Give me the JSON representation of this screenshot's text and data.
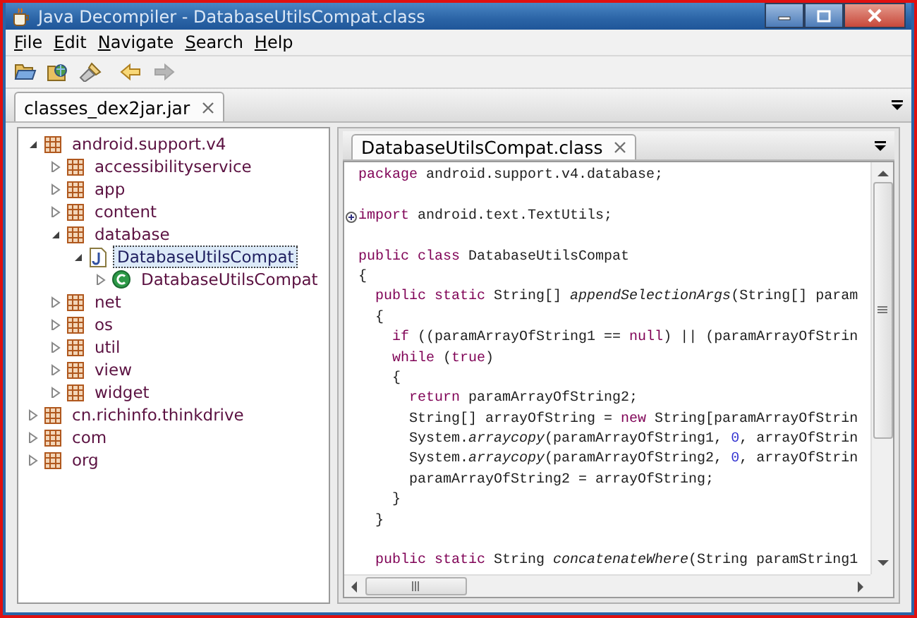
{
  "window": {
    "title": "Java Decompiler - DatabaseUtilsCompat.class"
  },
  "menu": [
    {
      "label": "File"
    },
    {
      "label": "Edit"
    },
    {
      "label": "Navigate"
    },
    {
      "label": "Search"
    },
    {
      "label": "Help"
    }
  ],
  "toolbar": [
    {
      "kind": "open",
      "disabled": false
    },
    {
      "kind": "open-type",
      "disabled": false
    },
    {
      "kind": "search",
      "disabled": false
    },
    {
      "kind": "back",
      "disabled": false
    },
    {
      "kind": "forward",
      "disabled": true
    }
  ],
  "file_tabs": [
    {
      "label": "classes_dex2jar.jar",
      "selected": true
    }
  ],
  "tree": [
    {
      "label": "android.support.v4",
      "kind": "package",
      "expanded": true,
      "selected": false,
      "children": [
        {
          "label": "accessibilityservice",
          "kind": "package",
          "expanded": false,
          "selected": false
        },
        {
          "label": "app",
          "kind": "package",
          "expanded": false,
          "selected": false
        },
        {
          "label": "content",
          "kind": "package",
          "expanded": false,
          "selected": false
        },
        {
          "label": "database",
          "kind": "package",
          "expanded": true,
          "selected": false,
          "children": [
            {
              "label": "DatabaseUtilsCompat",
              "kind": "file",
              "expanded": true,
              "selected": true,
              "children": [
                {
                  "label": "DatabaseUtilsCompat",
                  "kind": "class",
                  "expanded": false,
                  "selected": false
                }
              ]
            }
          ]
        },
        {
          "label": "net",
          "kind": "package",
          "expanded": false,
          "selected": false
        },
        {
          "label": "os",
          "kind": "package",
          "expanded": false,
          "selected": false
        },
        {
          "label": "util",
          "kind": "package",
          "expanded": false,
          "selected": false
        },
        {
          "label": "view",
          "kind": "package",
          "expanded": false,
          "selected": false
        },
        {
          "label": "widget",
          "kind": "package",
          "expanded": false,
          "selected": false
        }
      ]
    },
    {
      "label": "cn.richinfo.thinkdrive",
      "kind": "package",
      "expanded": false,
      "selected": false
    },
    {
      "label": "com",
      "kind": "package",
      "expanded": false,
      "selected": false
    },
    {
      "label": "org",
      "kind": "package",
      "expanded": false,
      "selected": false
    }
  ],
  "editor_tabs": [
    {
      "label": "DatabaseUtilsCompat.class",
      "selected": true
    }
  ],
  "code": {
    "lines": [
      {
        "folded": false,
        "tokens": [
          {
            "t": "package",
            "kind": "kw"
          },
          {
            "t": " android.support.v4.database;",
            "kind": "plain"
          }
        ]
      },
      {
        "folded": false
      },
      {
        "folded": true,
        "tokens": [
          {
            "t": "import",
            "kind": "kw"
          },
          {
            "t": " android.text.TextUtils;",
            "kind": "plain"
          }
        ]
      },
      {
        "folded": false
      },
      {
        "folded": false,
        "tokens": [
          {
            "t": "public class",
            "kind": "kw"
          },
          {
            "t": " DatabaseUtilsCompat",
            "kind": "plain"
          }
        ]
      },
      {
        "folded": false,
        "tokens": [
          {
            "t": "{",
            "kind": "plain"
          }
        ]
      },
      {
        "folded": false,
        "tokens": [
          {
            "t": "  public static",
            "kind": "kw"
          },
          {
            "t": " String[] ",
            "kind": "plain"
          },
          {
            "t": "appendSelectionArgs",
            "kind": "italic"
          },
          {
            "t": "(String[] param",
            "kind": "plain"
          }
        ]
      },
      {
        "folded": false,
        "tokens": [
          {
            "t": "  {",
            "kind": "plain"
          }
        ]
      },
      {
        "folded": false,
        "tokens": [
          {
            "t": "    if",
            "kind": "kw"
          },
          {
            "t": " ((paramArrayOfString1 == ",
            "kind": "plain"
          },
          {
            "t": "null",
            "kind": "kw"
          },
          {
            "t": ") || (paramArrayOfStrin",
            "kind": "plain"
          }
        ]
      },
      {
        "folded": false,
        "tokens": [
          {
            "t": "    while",
            "kind": "kw"
          },
          {
            "t": " (",
            "kind": "plain"
          },
          {
            "t": "true",
            "kind": "kw"
          },
          {
            "t": ")",
            "kind": "plain"
          }
        ]
      },
      {
        "folded": false,
        "tokens": [
          {
            "t": "    {",
            "kind": "plain"
          }
        ]
      },
      {
        "folded": false,
        "tokens": [
          {
            "t": "      return",
            "kind": "kw"
          },
          {
            "t": " paramArrayOfString2;",
            "kind": "plain"
          }
        ]
      },
      {
        "folded": false,
        "tokens": [
          {
            "t": "      String[] arrayOfString = ",
            "kind": "plain"
          },
          {
            "t": "new",
            "kind": "kw"
          },
          {
            "t": " String[paramArrayOfStrin",
            "kind": "plain"
          }
        ]
      },
      {
        "folded": false,
        "tokens": [
          {
            "t": "      System.",
            "kind": "plain"
          },
          {
            "t": "arraycopy",
            "kind": "italic"
          },
          {
            "t": "(paramArrayOfString1, ",
            "kind": "plain"
          },
          {
            "t": "0",
            "kind": "num"
          },
          {
            "t": ", arrayOfStrin",
            "kind": "plain"
          }
        ]
      },
      {
        "folded": false,
        "tokens": [
          {
            "t": "      System.",
            "kind": "plain"
          },
          {
            "t": "arraycopy",
            "kind": "italic"
          },
          {
            "t": "(paramArrayOfString2, ",
            "kind": "plain"
          },
          {
            "t": "0",
            "kind": "num"
          },
          {
            "t": ", arrayOfStrin",
            "kind": "plain"
          }
        ]
      },
      {
        "folded": false,
        "tokens": [
          {
            "t": "      paramArrayOfString2 = arrayOfString;",
            "kind": "plain"
          }
        ]
      },
      {
        "folded": false,
        "tokens": [
          {
            "t": "    }",
            "kind": "plain"
          }
        ]
      },
      {
        "folded": false,
        "tokens": [
          {
            "t": "  }",
            "kind": "plain"
          }
        ]
      },
      {
        "folded": false
      },
      {
        "folded": false,
        "tokens": [
          {
            "t": "  public static",
            "kind": "kw"
          },
          {
            "t": " String ",
            "kind": "plain"
          },
          {
            "t": "concatenateWhere",
            "kind": "italic"
          },
          {
            "t": "(String paramString1",
            "kind": "plain"
          }
        ]
      }
    ]
  }
}
